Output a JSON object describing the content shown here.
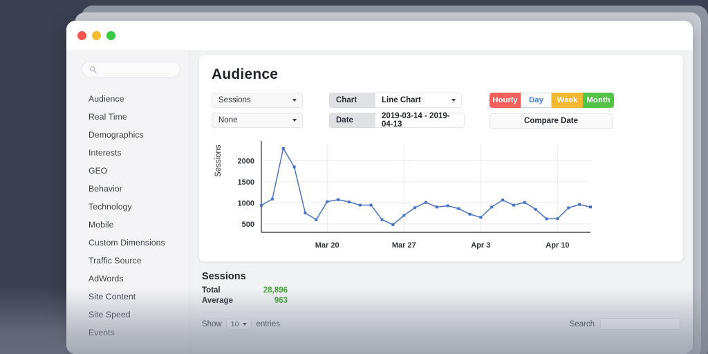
{
  "window": {
    "traffic_lights": [
      "close",
      "minimize",
      "zoom"
    ]
  },
  "sidebar": {
    "search_placeholder": "",
    "search_icon": "search-icon",
    "items": [
      {
        "label": "Audience"
      },
      {
        "label": "Real Time"
      },
      {
        "label": "Demographics"
      },
      {
        "label": "Interests"
      },
      {
        "label": "GEO"
      },
      {
        "label": "Behavior"
      },
      {
        "label": "Technology"
      },
      {
        "label": "Mobile"
      },
      {
        "label": "Custom Dimensions"
      },
      {
        "label": "Traffic Source"
      },
      {
        "label": "AdWords"
      },
      {
        "label": "Site Content"
      },
      {
        "label": "Site Speed"
      },
      {
        "label": "Events"
      }
    ]
  },
  "page": {
    "title": "Audience"
  },
  "controls": {
    "metric_select": {
      "value": "Sessions"
    },
    "secondary_select": {
      "value": "None"
    },
    "chart_group": {
      "label": "Chart",
      "value": "Line Chart"
    },
    "date_group": {
      "label": "Date",
      "value": "2019-03-14 - 2019-04-13"
    },
    "interval_buttons": [
      {
        "label": "Hourly",
        "color": "#f35f5a",
        "active": false
      },
      {
        "label": "Day",
        "color": "#ffffff",
        "active": true
      },
      {
        "label": "Week",
        "color": "#f5b831",
        "active": false
      },
      {
        "label": "Month",
        "color": "#53c447",
        "active": false
      }
    ],
    "compare_button": {
      "label": "Compare Date"
    }
  },
  "chart_data": {
    "type": "line",
    "title": "",
    "xlabel": "",
    "ylabel": "Sessions",
    "ylim": [
      300,
      2400
    ],
    "yticks": [
      500,
      1000,
      1500,
      2000
    ],
    "xticks": [
      "Mar 20",
      "Mar 27",
      "Apr 3",
      "Apr 10"
    ],
    "xtick_indices": [
      6,
      13,
      20,
      27
    ],
    "grid": true,
    "legend": "none",
    "line_color": "#4a72c4",
    "marker_color": "#4a72c4",
    "series": [
      {
        "name": "Sessions",
        "values": [
          940,
          1090,
          2290,
          1850,
          760,
          600,
          1025,
          1075,
          1020,
          945,
          945,
          600,
          480,
          700,
          885,
          1010,
          900,
          930,
          860,
          730,
          655,
          900,
          1065,
          945,
          1010,
          845,
          620,
          625,
          880,
          960,
          900
        ]
      }
    ]
  },
  "summary": {
    "heading": "Sessions",
    "rows": [
      {
        "key": "Total",
        "value": "28,896"
      },
      {
        "key": "Average",
        "value": "963"
      }
    ],
    "value_color": "#4aa73e"
  },
  "table_controls": {
    "show_label": "Show",
    "page_size": "10",
    "entries_label": "entries",
    "search_label": "Search",
    "search_value": ""
  }
}
